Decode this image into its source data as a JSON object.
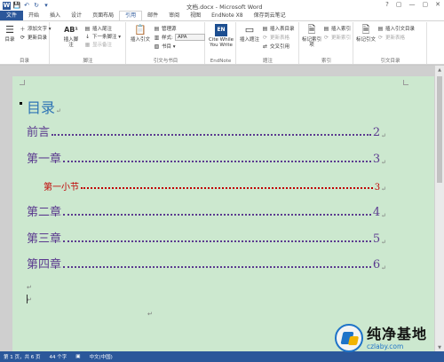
{
  "window": {
    "title": "文档.docx - Microsoft Word",
    "controls": [
      "?",
      "▢",
      "—",
      "▢",
      "✕"
    ]
  },
  "quick_access": {
    "save_glyph": "💾",
    "undo_glyph": "↶",
    "redo_glyph": "↻",
    "more_glyph": "▾",
    "logo_letter": "W"
  },
  "tabs": [
    {
      "label": "文件",
      "kind": "file"
    },
    {
      "label": "开始"
    },
    {
      "label": "插入"
    },
    {
      "label": "设计"
    },
    {
      "label": "页面布局"
    },
    {
      "label": "引用",
      "kind": "active"
    },
    {
      "label": "邮件"
    },
    {
      "label": "审阅"
    },
    {
      "label": "视图"
    },
    {
      "label": "EndNote X8"
    },
    {
      "label": "保存到云笔记"
    }
  ],
  "ribbon": {
    "toc": {
      "big_label": "目录",
      "add_text": "添加文字 ▾",
      "update": "更新目录",
      "group": "目录"
    },
    "footnotes": {
      "big_label": "插入脚注",
      "insert_endnote": "插入尾注",
      "next_footnote": "下一条脚注 ▾",
      "show_notes": "显示备注",
      "group": "脚注"
    },
    "citations": {
      "big_label": "插入引文",
      "manage": "管理源",
      "style_label": "样式:",
      "style_value": "APA",
      "bibliography": "书目 ▾",
      "group": "引文与书目"
    },
    "endnote": {
      "big_label": "Cite While You Write",
      "group": "EndNote"
    },
    "captions": {
      "big_label": "插入题注",
      "insert_table_fig": "插入表目录",
      "update_table": "更新表格",
      "cross_ref": "交叉引用",
      "group": "题注"
    },
    "index": {
      "big_label": "标记索引项",
      "insert_index": "插入索引",
      "update_index": "更新索引",
      "group": "索引"
    },
    "authorities": {
      "big_label": "标记引文",
      "insert_auth": "插入引文目录",
      "update_auth": "更新表格",
      "group": "引文目录"
    }
  },
  "document": {
    "toc_title": "目录",
    "return_mark": "↵",
    "entries": [
      {
        "text": "前言",
        "page": "2",
        "level": 1
      },
      {
        "text": "第一章",
        "page": "3",
        "level": 1
      },
      {
        "text": "第一小节",
        "page": "3",
        "level": 2
      },
      {
        "text": "第二章",
        "page": "4",
        "level": 1
      },
      {
        "text": "第三章",
        "page": "5",
        "level": 1
      },
      {
        "text": "第四章",
        "page": "6",
        "level": 1
      }
    ]
  },
  "status": {
    "page": "第 1 页，共 6 页",
    "words": "44 个字",
    "lang": "中文(中国)"
  },
  "watermark": {
    "name": "纯净基地",
    "url": "czlaby.com"
  },
  "colors": {
    "accent": "#2b579a",
    "page_bg": "#cce8cf",
    "toc_title": "#2e74b5",
    "lvl1": "#5b3a8f",
    "lvl2": "#c00000"
  }
}
